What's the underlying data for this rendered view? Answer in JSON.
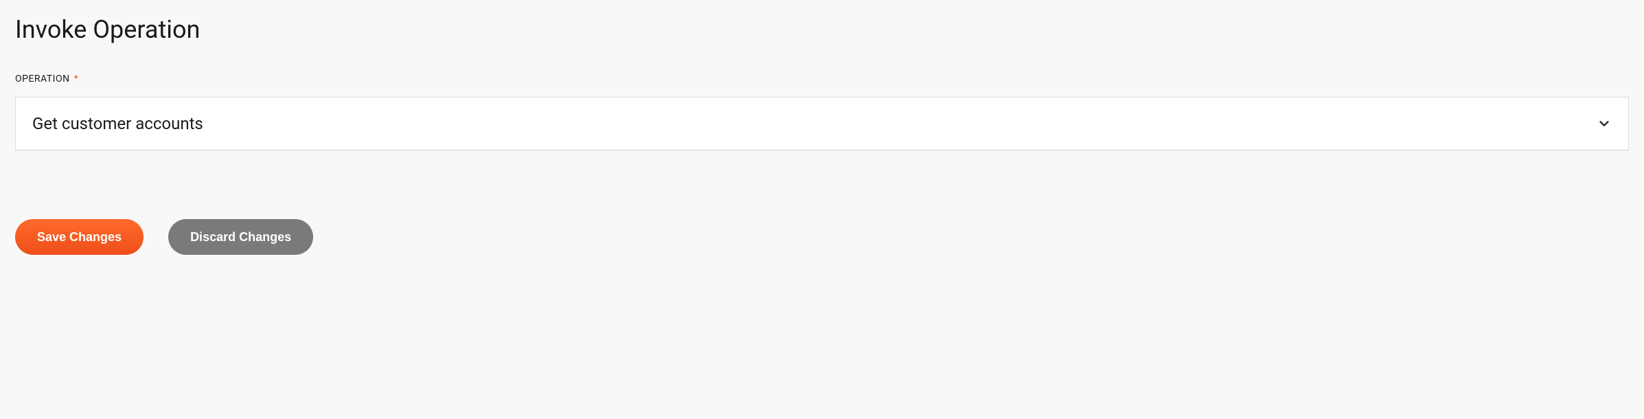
{
  "page": {
    "title": "Invoke Operation"
  },
  "field": {
    "label": "OPERATION",
    "required_marker": "*",
    "selected_value": "Get customer accounts"
  },
  "buttons": {
    "save_label": "Save Changes",
    "discard_label": "Discard Changes"
  }
}
